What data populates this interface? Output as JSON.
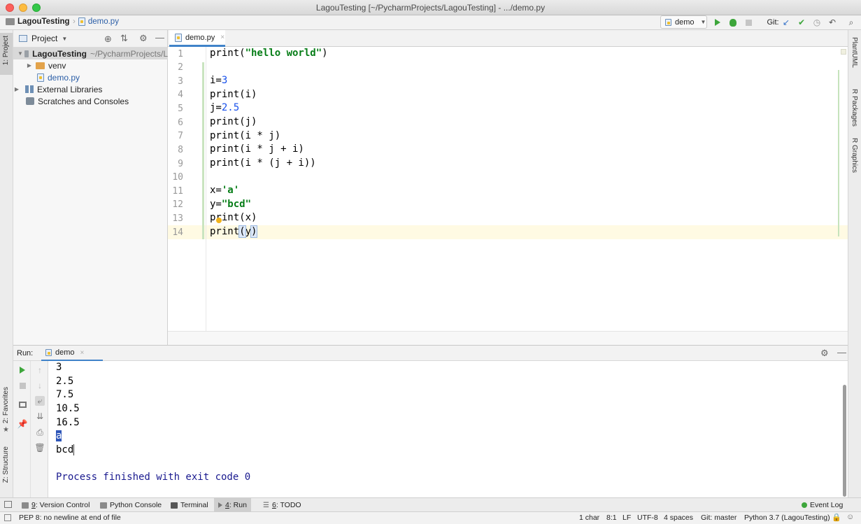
{
  "window": {
    "title": "LagouTesting [~/PycharmProjects/LagouTesting] - .../demo.py"
  },
  "navbar": {
    "project": "LagouTesting",
    "file": "demo.py",
    "run_config": "demo",
    "git_label": "Git:"
  },
  "left_strip": {
    "project_tab": "1: Project",
    "favorites_tab": "2: Favorites",
    "structure_tab": "Z: Structure"
  },
  "right_strip": {
    "tabs": [
      "PlantUML",
      "R Packages",
      "R Graphics"
    ]
  },
  "project": {
    "header": "Project",
    "tree": [
      {
        "label": "LagouTesting",
        "suffix": "~/PycharmProjects/L",
        "indent": 0,
        "icon": "folder-grey",
        "expanded": true
      },
      {
        "label": "venv",
        "suffix": "",
        "indent": 1,
        "icon": "folder-orange",
        "expanded": false
      },
      {
        "label": "demo.py",
        "suffix": "",
        "indent": 1,
        "icon": "python-file",
        "expanded": null
      },
      {
        "label": "External Libraries",
        "suffix": "",
        "indent": 0,
        "icon": "library",
        "expanded": false
      },
      {
        "label": "Scratches and Consoles",
        "suffix": "",
        "indent": 0,
        "icon": "console",
        "expanded": null
      }
    ]
  },
  "editor": {
    "tab_label": "demo.py",
    "current_line": 14,
    "lines": [
      "print(\"hello world\")",
      "",
      "i=3",
      "print(i)",
      "j=2.5",
      "print(j)",
      "print(i * j)",
      "print(i * j + i)",
      "print(i * (j + i))",
      "",
      "x='a'",
      "y=\"bcd\"",
      "print(x)",
      "print(y)"
    ]
  },
  "run": {
    "label": "Run:",
    "tab_label": "demo",
    "output": [
      "3",
      "2.5",
      "7.5",
      "10.5",
      "16.5",
      "a",
      "bcd",
      "",
      "Process finished with exit code 0"
    ]
  },
  "bottom_tabs": [
    {
      "num": "9",
      "label": ": Version Control"
    },
    {
      "num": "",
      "label": "Python Console"
    },
    {
      "num": "",
      "label": "Terminal"
    },
    {
      "num": "4",
      "label": ": Run"
    },
    {
      "num": "6",
      "label": ": TODO"
    }
  ],
  "event_log": "Event Log",
  "status": {
    "message": "PEP 8: no newline at end of file",
    "selection": "1 char",
    "position": "8:1",
    "line_sep": "LF",
    "encoding": "UTF-8",
    "indent": "4 spaces",
    "git_branch": "Git: master",
    "interpreter": "Python 3.7 (LagouTesting)"
  }
}
